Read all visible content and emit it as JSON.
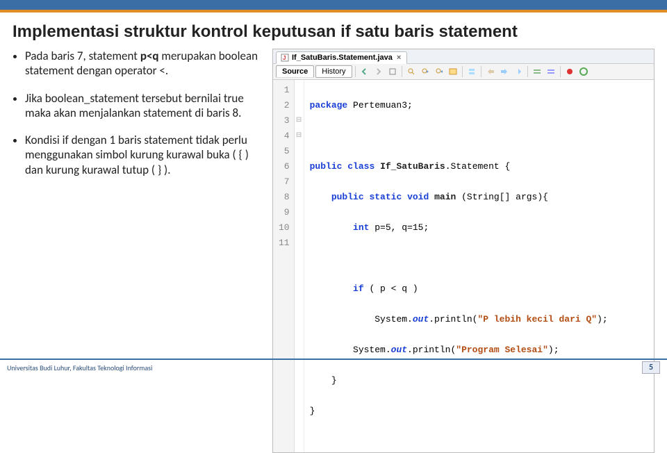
{
  "title": "Implementasi struktur kontrol keputusan if satu baris statement",
  "bullets": [
    {
      "pre": "Pada baris 7, statement ",
      "bold": "p<q",
      "post": " merupakan boolean statement dengan operator <."
    },
    {
      "pre": "Jika boolean_statement tersebut bernilai true maka akan menjalankan statement di baris 8.",
      "bold": "",
      "post": ""
    },
    {
      "pre": "Kondisi if dengan 1 baris statement tidak perlu menggunakan simbol kurung kurawal buka ( { ) dan kurung kurawal tutup ( } ).",
      "bold": "",
      "post": ""
    }
  ],
  "ide": {
    "file_tab": "If_SatuBaris.Statement.java",
    "tabs": {
      "source": "Source",
      "history": "History"
    },
    "icons": [
      "nav-back-icon",
      "nav-fwd-icon",
      "nav-up-icon",
      "find-icon",
      "find-prev-icon",
      "find-next-icon",
      "toggle-highlight-icon",
      "insert-icon",
      "shift-left-icon",
      "shift-right-icon",
      "format-icon",
      "uncomment-icon",
      "comment-icon",
      "record-macro-icon",
      "play-macro-icon"
    ],
    "line_numbers": [
      "1",
      "2",
      "3",
      "4",
      "5",
      "6",
      "7",
      "8",
      "9",
      "10",
      "11"
    ],
    "fold_markers": {
      "3": "⊟",
      "4": "⊟"
    },
    "code": {
      "l1": {
        "kw1": "package",
        "rest": " Pertemuan3;"
      },
      "l3": {
        "kw1": "public",
        "kw2": "class",
        "cls": "If_SatuBaris",
        "rest": ".Statement {"
      },
      "l4": {
        "indent": "    ",
        "kw1": "public",
        "kw2": "static",
        "kw3": "void",
        "mname": "main",
        "args": " (String[] args){"
      },
      "l5": {
        "indent": "        ",
        "kw": "int",
        "rest": " p=5, q=15;"
      },
      "l7": {
        "indent": "        ",
        "kw": "if",
        "rest": " ( p < q )"
      },
      "l8": {
        "indent": "            ",
        "obj": "System.",
        "ital": "out",
        "rest1": ".println(",
        "str": "\"P lebih kecil dari Q\"",
        "rest2": ");"
      },
      "l9": {
        "indent": "        ",
        "obj": "System.",
        "ital": "out",
        "rest1": ".println(",
        "str": "\"Program Selesai\"",
        "rest2": ");"
      },
      "l10": {
        "indent": "    ",
        "brace": "}"
      },
      "l11": {
        "indent": "",
        "brace": "}"
      }
    }
  },
  "footer": {
    "org": "Universitas Budi Luhur, Fakultas Teknologi Informasi",
    "page": "5"
  }
}
